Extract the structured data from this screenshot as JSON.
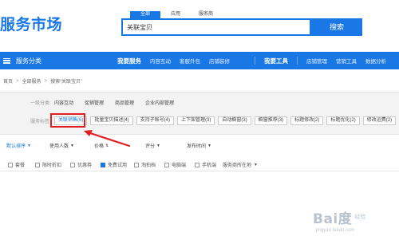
{
  "logo": {
    "text": "服务市场"
  },
  "search": {
    "tabs": [
      "全部",
      "应用",
      "服务商"
    ],
    "value": "关联宝贝",
    "button": "搜索"
  },
  "nav": {
    "category": "服务分类",
    "links": [
      "我要服务",
      "内容互动",
      "客服外包",
      "店铺装修"
    ],
    "tools_label": "我要工具",
    "tools": [
      "店铺管理",
      "营销工具",
      "数据分析"
    ]
  },
  "breadcrumb": {
    "items": [
      "首页",
      "全部服务",
      "搜索“关联宝贝”"
    ]
  },
  "filters": {
    "category_label": "一级分类:",
    "categories": [
      "内容互动",
      "促销管理",
      "商品管理",
      "企业内部管理"
    ],
    "tag_label": "服务标签:",
    "tags": [
      "关联销售(6)",
      "批量宝贝描述(4)",
      "支持子账号(4)",
      "上下架管理(3)",
      "自动橱窗(3)",
      "橱窗推荐(3)",
      "标题修改(2)",
      "标题优化(2)",
      "修改运费(2)"
    ]
  },
  "sort": {
    "items": [
      "默认排序",
      "使用人数",
      "价格",
      "评分",
      "发布时间"
    ]
  },
  "checks": {
    "items": [
      {
        "label": "套餐",
        "checked": false
      },
      {
        "label": "限时折扣",
        "checked": false
      },
      {
        "label": "优惠券",
        "checked": false
      },
      {
        "label": "免费试用",
        "checked": true
      },
      {
        "label": "淘拍档",
        "checked": false
      },
      {
        "label": "电脑端",
        "checked": false
      },
      {
        "label": "手机端",
        "checked": false
      }
    ],
    "location_label": "服务商所在地"
  },
  "colors": {
    "accent": "#1a78e6",
    "highlight": "#e02020"
  },
  "watermark": {
    "brand": "Bai度",
    "sub": "经验",
    "url": "jingyan.baidu.com"
  }
}
